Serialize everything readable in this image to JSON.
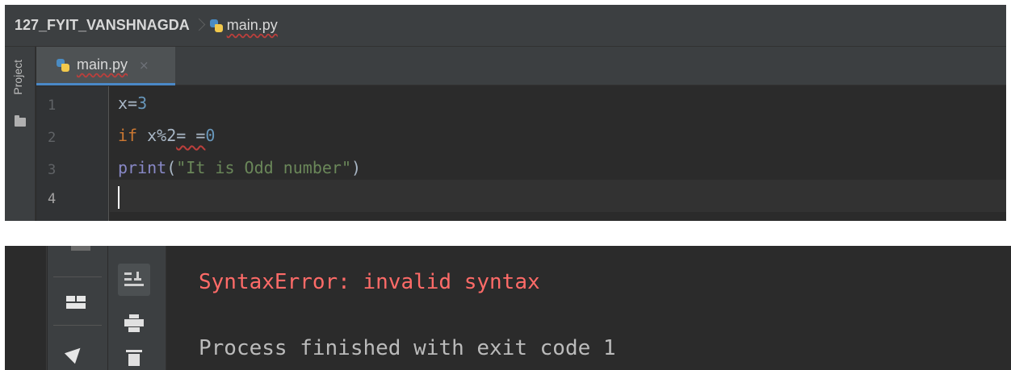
{
  "breadcrumb": {
    "project": "127_FYIT_VANSHNAGDA",
    "file": "main.py"
  },
  "sidebar": {
    "project_label": "Project"
  },
  "tabs": [
    {
      "label": "main.py",
      "close": "×"
    }
  ],
  "editor": {
    "line_numbers": [
      "1",
      "2",
      "3",
      "4"
    ],
    "lines": [
      [
        {
          "t": "x=",
          "k": "plain"
        },
        {
          "t": "3",
          "k": "num"
        }
      ],
      [
        {
          "t": "if",
          "k": "kw"
        },
        {
          "t": " x%2",
          "k": "plain"
        },
        {
          "t": "= =",
          "k": "err"
        },
        {
          "t": "0",
          "k": "num"
        }
      ],
      [
        {
          "t": "print",
          "k": "fn"
        },
        {
          "t": "(",
          "k": "plain"
        },
        {
          "t": "\"It is Odd number\"",
          "k": "str"
        },
        {
          "t": ")",
          "k": "plain"
        }
      ],
      []
    ],
    "current_line": 4
  },
  "console": {
    "error": "SyntaxError: invalid syntax",
    "exit": "Process finished with exit code 1"
  },
  "colors": {
    "editor_bg": "#2b2b2b",
    "keyword": "#cc7832",
    "number": "#6897bb",
    "builtin": "#8888c6",
    "string": "#6a8759",
    "error_text": "#ff6b68",
    "tab_accent": "#4a88c7"
  },
  "icons": {
    "file": "python-file-icon",
    "soft_wrap": "scroll-to-end-icon",
    "print": "print-icon",
    "trash": "trash-icon",
    "layout": "restore-layout-icon",
    "pin": "pin-icon",
    "folder": "folder-icon"
  }
}
